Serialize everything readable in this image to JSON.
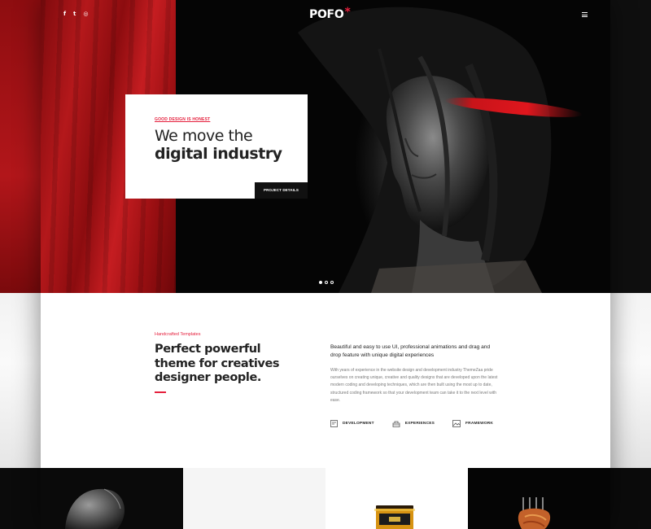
{
  "topbar": {
    "social": [
      {
        "icon": "facebook-icon",
        "glyph": "f"
      },
      {
        "icon": "twitter-icon",
        "glyph": "t"
      },
      {
        "icon": "dribbble-icon",
        "glyph": "◎"
      }
    ],
    "logo": "POFO",
    "logo_mark": "*",
    "menu_icon": "hamburger-icon"
  },
  "hero": {
    "eyebrow": "GOOD DESIGN IS HONEST",
    "title_line1": "We move the",
    "title_line2": "digital industry",
    "button": "PROJECT DETAILS",
    "slides": 3,
    "active_slide": 1
  },
  "about": {
    "eyebrow": "Handcrafted Templates",
    "title_lines": [
      "Perfect powerful",
      "theme for creatives",
      "designer people."
    ],
    "lead": "Beautiful and easy to use UI, professional animations and drag and drop feature with unique digital experiences",
    "body": "With years of experience in the website design and development industry ThemeZaa pride ourselves on creating unique, creative and quality designs that are developed upon the latest modern coding and developing techniques, which are then built using the most up to date, structured coding framework so that your development team can take it to the next level with ease.",
    "features": [
      {
        "icon": "development-icon",
        "label": "DEVELOPMENT"
      },
      {
        "icon": "experiences-icon",
        "label": "EXPERIENCES"
      },
      {
        "icon": "framework-icon",
        "label": "FRAMEWORK"
      }
    ]
  },
  "colors": {
    "accent": "#e5203d",
    "dark": "#232323",
    "hero_red": "#b4181b"
  }
}
